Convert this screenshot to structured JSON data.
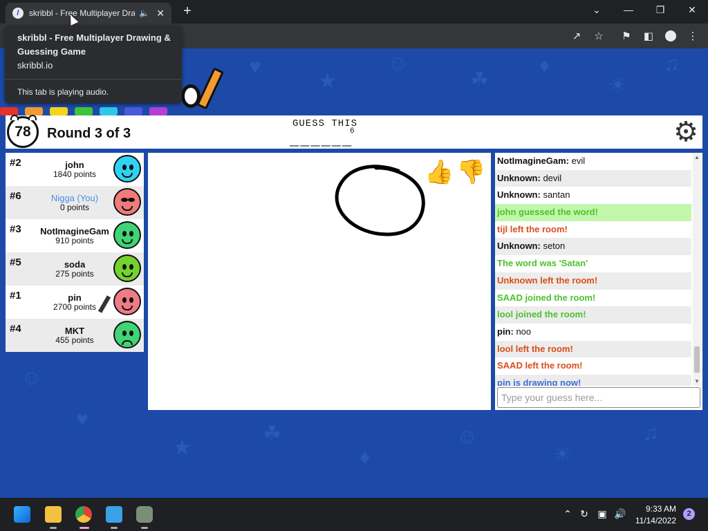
{
  "browser": {
    "tab_title": "skribbl - Free Multiplayer Dra",
    "tab_favicon": "pencil-favicon-icon",
    "audio_icon": "speaker-icon",
    "tooltip": {
      "title": "skribbl - Free Multiplayer Drawing & Guessing Game",
      "url": "skribbl.io",
      "audio_note": "This tab is playing audio."
    }
  },
  "game": {
    "timer": "78",
    "round_label": "Round 3 of 3",
    "guess_label": "GUESS THIS",
    "word_blanks": "______",
    "word_length": "6"
  },
  "players": [
    {
      "rank": "#2",
      "name": "john",
      "points": "1840 points",
      "color": "#2fd3f2",
      "is_you": false,
      "drawing": false
    },
    {
      "rank": "#6",
      "name": "Nigga (You)",
      "points": "0 points",
      "color": "#f07b7b",
      "is_you": true,
      "drawing": false
    },
    {
      "rank": "#3",
      "name": "NotImagineGam",
      "points": "910 points",
      "color": "#3fd474",
      "is_you": false,
      "drawing": false
    },
    {
      "rank": "#5",
      "name": "soda",
      "points": "275 points",
      "color": "#75d12e",
      "is_you": false,
      "drawing": false
    },
    {
      "rank": "#1",
      "name": "pin",
      "points": "2700 points",
      "color": "#f07b84",
      "is_you": false,
      "drawing": true
    },
    {
      "rank": "#4",
      "name": "MKT",
      "points": "455 points",
      "color": "#3fd474",
      "is_you": false,
      "drawing": false
    }
  ],
  "chat": {
    "messages": [
      {
        "author": "NotImagineGam:",
        "text": " evil",
        "style": "normal"
      },
      {
        "author": "Unknown:",
        "text": " devil",
        "style": "normal"
      },
      {
        "author": "Unknown:",
        "text": " santan",
        "style": "normal"
      },
      {
        "author": "",
        "text": "john guessed the word!",
        "style": "guessed"
      },
      {
        "author": "",
        "text": "tijl left the room!",
        "style": "red"
      },
      {
        "author": "Unknown:",
        "text": " seton",
        "style": "normal"
      },
      {
        "author": "",
        "text": "The word was 'Satan'",
        "style": "green"
      },
      {
        "author": "",
        "text": "Unknown left the room!",
        "style": "red"
      },
      {
        "author": "",
        "text": "SAAD joined the room!",
        "style": "green"
      },
      {
        "author": "",
        "text": "lool joined the room!",
        "style": "green"
      },
      {
        "author": "pin:",
        "text": " noo",
        "style": "normal"
      },
      {
        "author": "",
        "text": "lool left the room!",
        "style": "red"
      },
      {
        "author": "",
        "text": "SAAD left the room!",
        "style": "red"
      },
      {
        "author": "",
        "text": "pin is drawing now!",
        "style": "blue"
      }
    ],
    "input_placeholder": "Type your guess here..."
  },
  "taskbar": {
    "time": "9:33 AM",
    "date": "11/14/2022",
    "notification_count": "2"
  },
  "colors": {
    "background": "#1d4aa8",
    "like": "#7ec86a",
    "dislike": "#e07a7a"
  }
}
